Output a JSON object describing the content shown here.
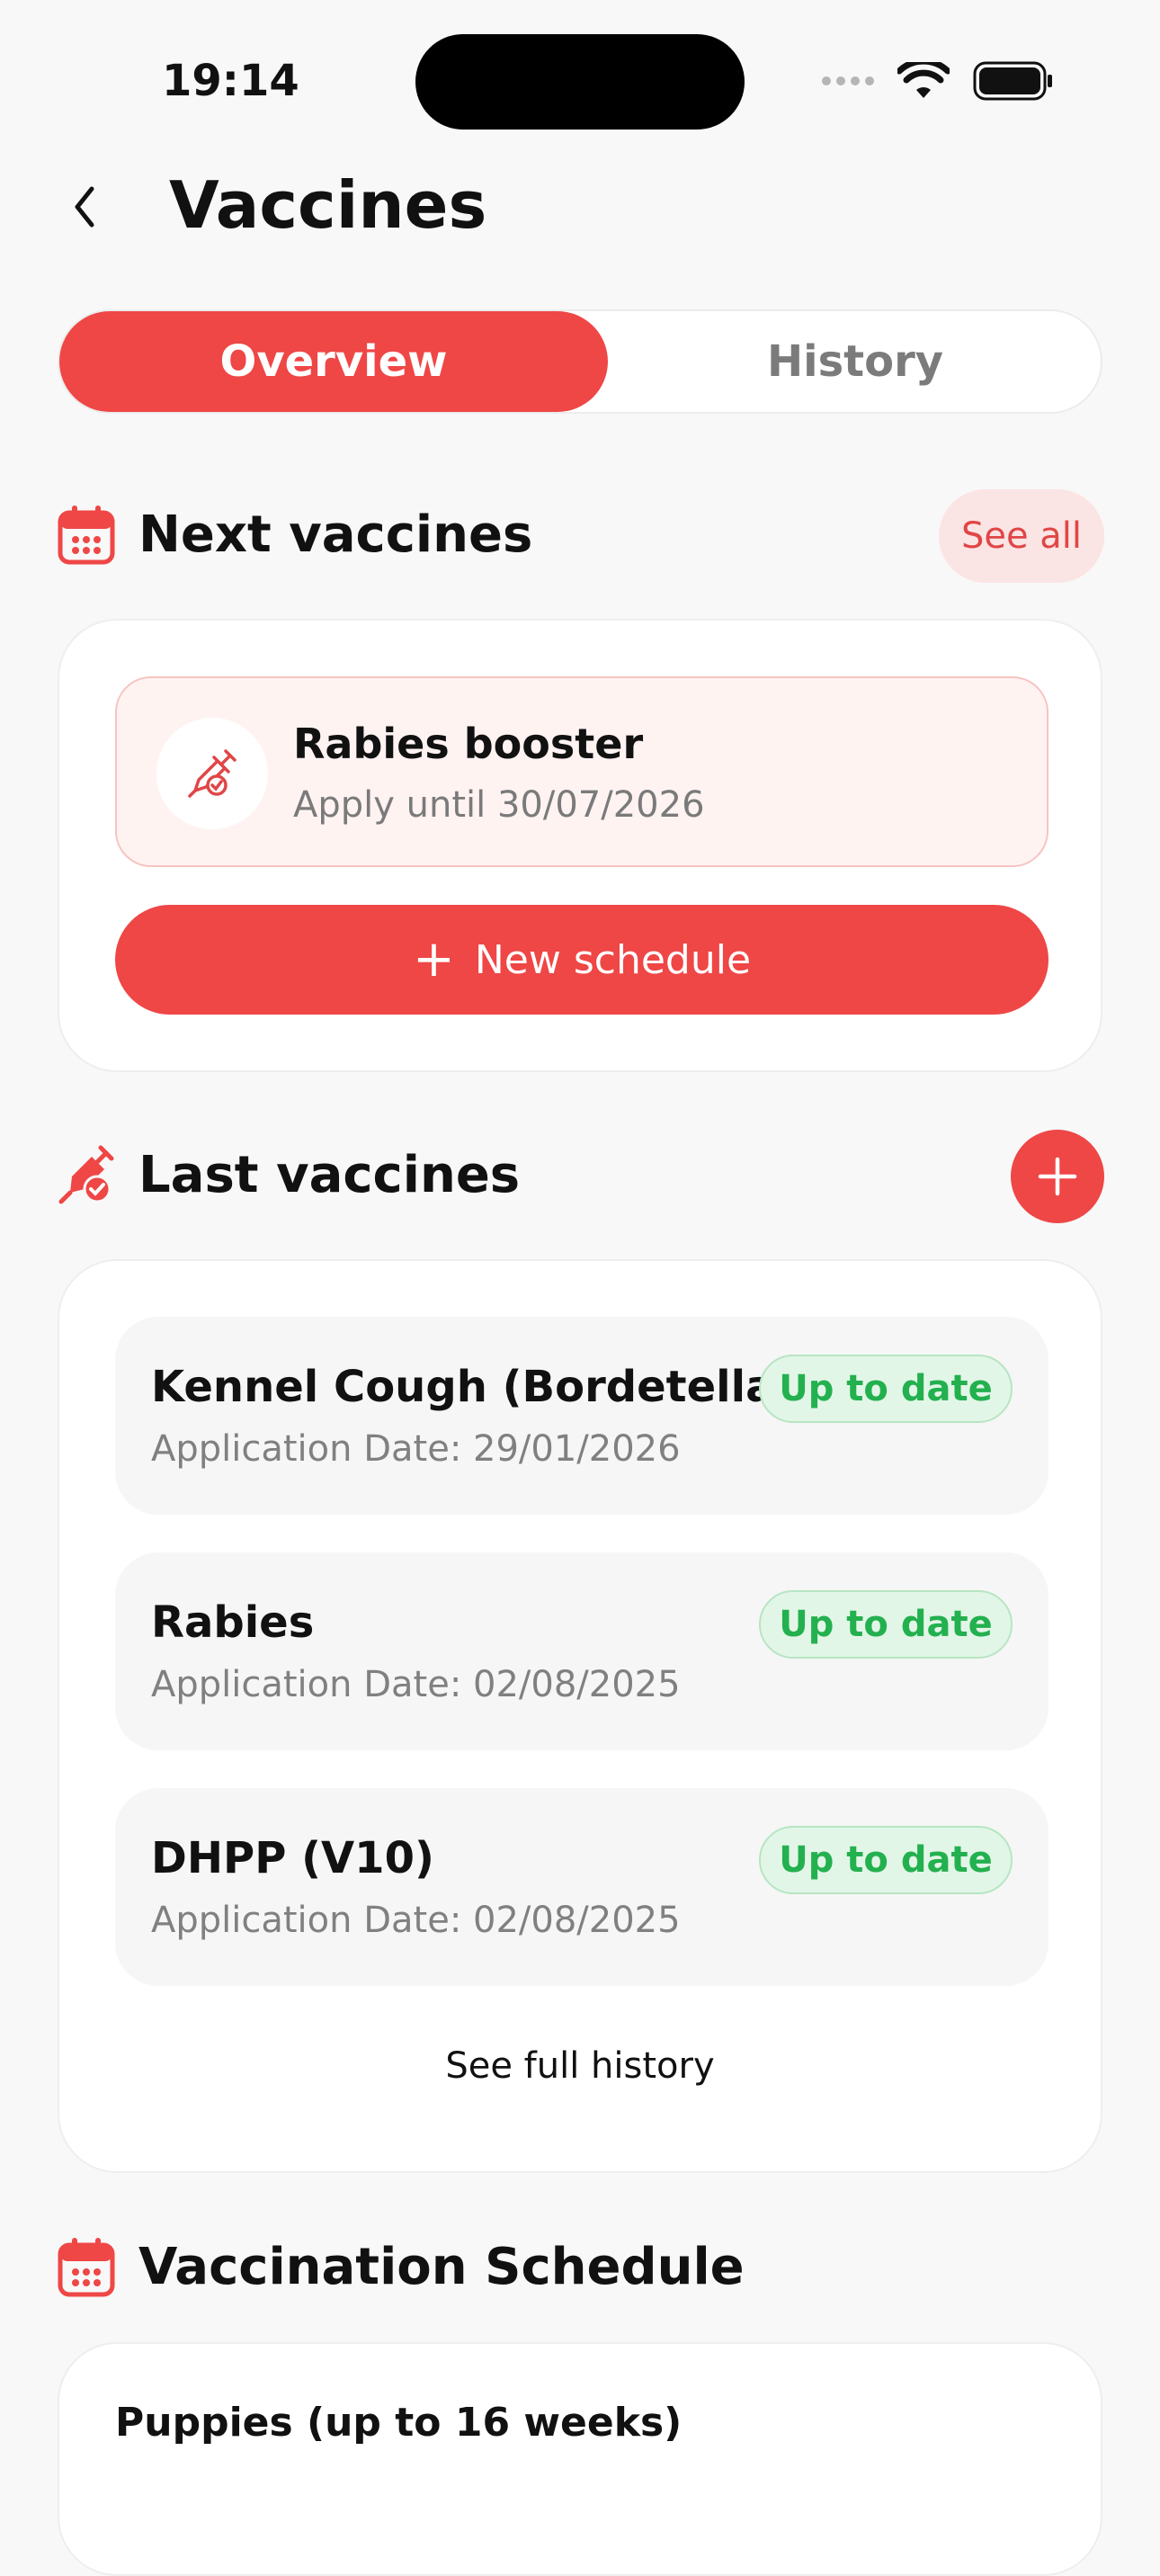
{
  "status": {
    "time": "19:14"
  },
  "header": {
    "title": "Vaccines"
  },
  "tabs": [
    {
      "label": "Overview",
      "active": true
    },
    {
      "label": "History",
      "active": false
    }
  ],
  "next_vaccines": {
    "title": "Next vaccines",
    "see_all": "See all",
    "item": {
      "name": "Rabies booster",
      "due": "Apply until 30/07/2026"
    },
    "new_schedule": "New schedule"
  },
  "last_vaccines": {
    "title": "Last vaccines",
    "items": [
      {
        "name": "Kennel Cough (Bordetella)",
        "date": "Application Date: 29/01/2026",
        "status": "Up to date"
      },
      {
        "name": "Rabies",
        "date": "Application Date: 02/08/2025",
        "status": "Up to date"
      },
      {
        "name": "DHPP (V10)",
        "date": "Application Date: 02/08/2025",
        "status": "Up to date"
      }
    ],
    "full_history": "See full history"
  },
  "vaccination_schedule": {
    "title": "Vaccination Schedule",
    "group": "Puppies (up to 16 weeks)"
  },
  "colors": {
    "accent": "#ef4646",
    "success": "#23b04f",
    "success_bg": "#e2f6e7"
  }
}
